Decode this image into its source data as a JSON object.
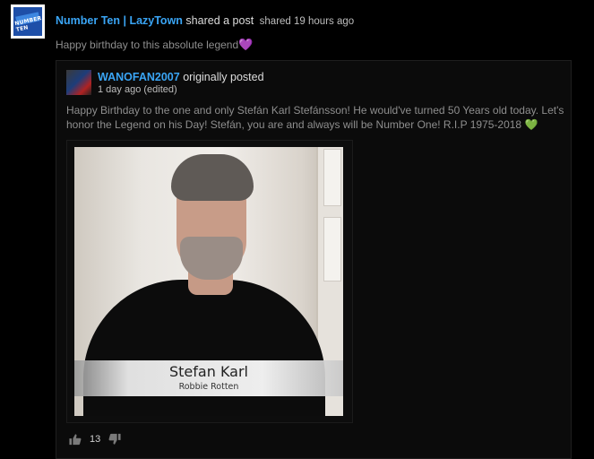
{
  "post": {
    "author": "Number Ten | LazyTown",
    "action": "shared a post",
    "timestamp": "shared 19 hours ago",
    "caption": "Happy birthday to this absolute legend",
    "caption_emoji": "💜",
    "avatar_logo_text": "NUMBER TEN"
  },
  "original": {
    "author": "WANOFAN2007",
    "action": "originally posted",
    "timestamp": "1 day ago (edited)",
    "text": "Happy Birthday to the one and only Stefán Karl Stefánsson! He would've turned 50 Years old today. Let's honor the Legend on his Day! Stefán, you are and always will be Number One! R.I.P 1975-2018",
    "text_emoji": "💚",
    "video": {
      "lower_third_name": "Stefan Karl",
      "lower_third_role": "Robbie Rotten"
    }
  },
  "actions": {
    "upvote_count": "13",
    "upvote_icon": "thumbs-up-icon",
    "downvote_icon": "thumbs-down-icon"
  },
  "colors": {
    "background": "#000000",
    "link": "#3aa5f5",
    "muted_text": "#8e8e8e"
  }
}
